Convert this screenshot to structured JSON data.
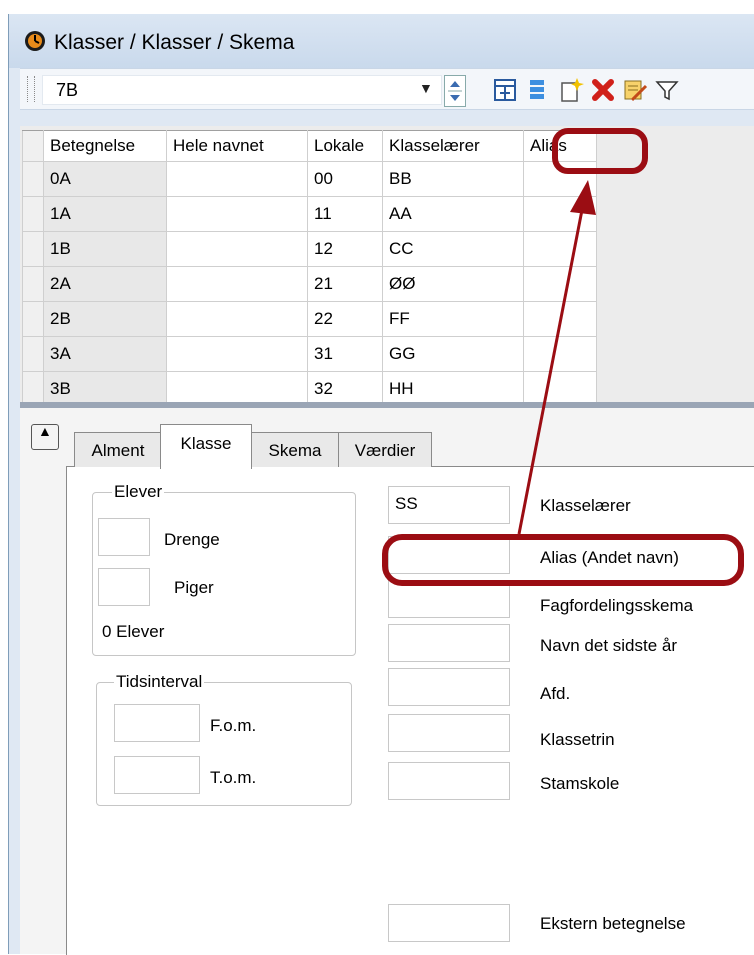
{
  "window": {
    "title": "Klasser / Klasser / Skema"
  },
  "toolbar": {
    "class_select": {
      "value": "7B"
    },
    "icons": [
      "grid-layout-icon",
      "list-icon",
      "new-item-icon",
      "delete-icon",
      "edit-icon",
      "filter-icon"
    ]
  },
  "grid": {
    "headers": {
      "betegnelse": "Betegnelse",
      "hele_navnet": "Hele navnet",
      "lokale": "Lokale",
      "klasselaerer": "Klasselærer",
      "alias": "Alias"
    },
    "rows": [
      {
        "betegnelse": "0A",
        "hele_navnet": "",
        "lokale": "00",
        "klasselaerer": "BB",
        "alias": ""
      },
      {
        "betegnelse": "1A",
        "hele_navnet": "",
        "lokale": "11",
        "klasselaerer": "AA",
        "alias": ""
      },
      {
        "betegnelse": "1B",
        "hele_navnet": "",
        "lokale": "12",
        "klasselaerer": "CC",
        "alias": ""
      },
      {
        "betegnelse": "2A",
        "hele_navnet": "",
        "lokale": "21",
        "klasselaerer": "ØØ",
        "alias": ""
      },
      {
        "betegnelse": "2B",
        "hele_navnet": "",
        "lokale": "22",
        "klasselaerer": "FF",
        "alias": ""
      },
      {
        "betegnelse": "3A",
        "hele_navnet": "",
        "lokale": "31",
        "klasselaerer": "GG",
        "alias": ""
      },
      {
        "betegnelse": "3B",
        "hele_navnet": "",
        "lokale": "32",
        "klasselaerer": "HH",
        "alias": ""
      }
    ]
  },
  "tabs": [
    {
      "label": "Alment",
      "active": false
    },
    {
      "label": "Klasse",
      "active": true
    },
    {
      "label": "Skema",
      "active": false
    },
    {
      "label": "Værdier",
      "active": false
    }
  ],
  "elever": {
    "title": "Elever",
    "drenge_label": "Drenge",
    "piger_label": "Piger",
    "total": "0 Elever"
  },
  "tidsinterval": {
    "title": "Tidsinterval",
    "fom_label": "F.o.m.",
    "tom_label": "T.o.m."
  },
  "fields": {
    "klasselaerer": {
      "label": "Klasselærer",
      "value": "SS"
    },
    "alias": {
      "label": "Alias (Andet navn)",
      "value": ""
    },
    "fagfordelingsskema": {
      "label": "Fagfordelingsskema",
      "value": ""
    },
    "navn_sidste_aar": {
      "label": "Navn det sidste år",
      "value": ""
    },
    "afd": {
      "label": "Afd.",
      "value": ""
    },
    "klassetrin": {
      "label": "Klassetrin",
      "value": ""
    },
    "stamskole": {
      "label": "Stamskole",
      "value": ""
    },
    "ekstern": {
      "label": "Ekstern betegnelse",
      "value": ""
    }
  },
  "colors": {
    "highlight": "#9b0d13",
    "titlebar": "#d6e2f1",
    "accent": "#1f6fd1"
  }
}
